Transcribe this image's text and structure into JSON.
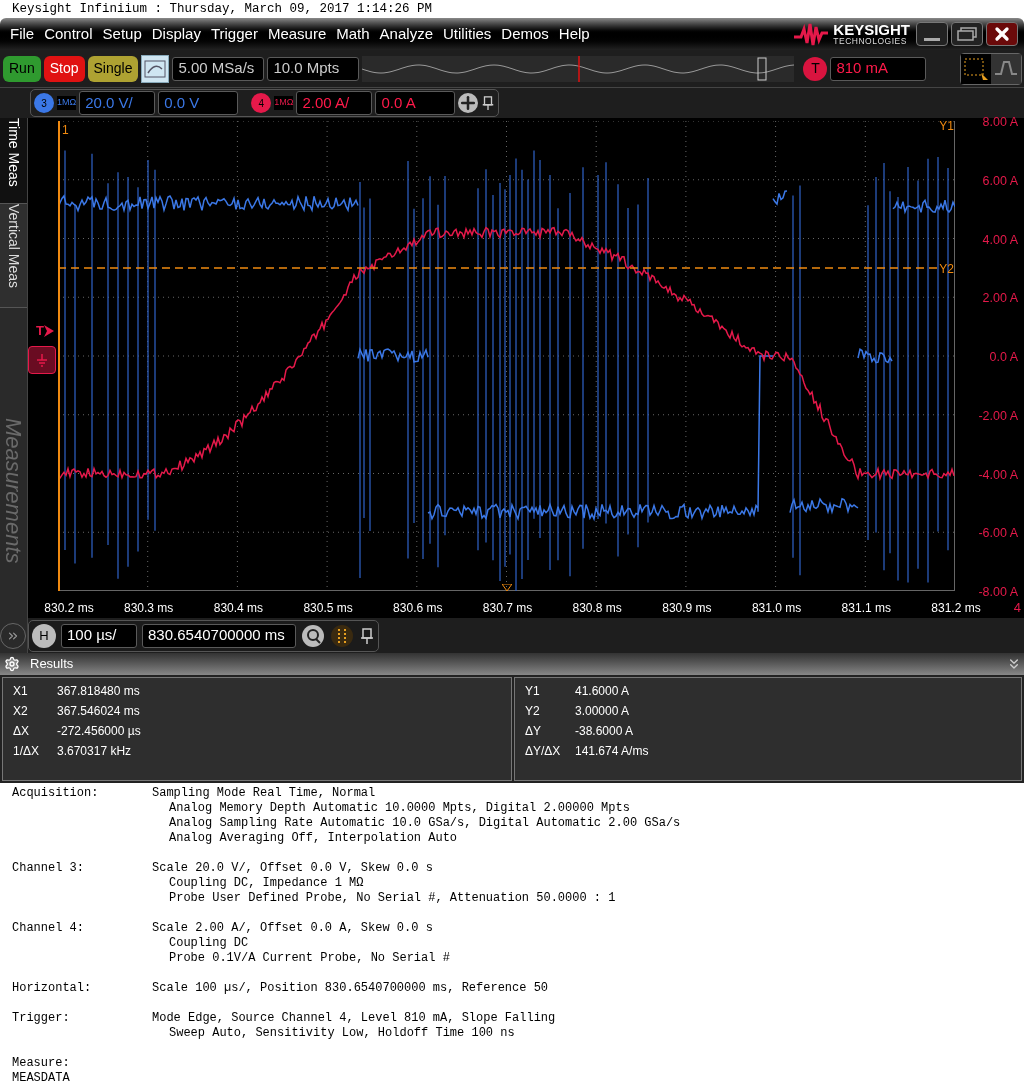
{
  "title_bar": {
    "text": "Keysight Infiniium : Thursday, March 09, 2017 1:14:26 PM"
  },
  "menu": [
    "File",
    "Control",
    "Setup",
    "Display",
    "Trigger",
    "Measure",
    "Math",
    "Analyze",
    "Utilities",
    "Demos",
    "Help"
  ],
  "logo": {
    "name": "KEYSIGHT",
    "subtitle": "TECHNOLOGIES"
  },
  "acquisition_buttons": [
    {
      "label": "Run",
      "color": "#2f9a2f"
    },
    {
      "label": "Stop",
      "color": "#e01212"
    },
    {
      "label": "Single",
      "color": "#aea232"
    }
  ],
  "sample_rate": "5.00 MSa/s",
  "memory_depth": "10.0 Mpts",
  "trigger": {
    "badge": "T",
    "level": "810 mA"
  },
  "view_modes": [
    {
      "kind": "select",
      "selected": true
    },
    {
      "kind": "waveform",
      "selected": false
    }
  ],
  "channels": [
    {
      "number": "3",
      "impedance": "1MΩ",
      "scale": "20.0 V/",
      "offset": "0.0 V",
      "color": "#3b78e7"
    },
    {
      "number": "4",
      "impedance": "1MΩ",
      "scale": "2.00 A/",
      "offset": "0.0 A",
      "color": "#e5194a"
    }
  ],
  "side_tabs": [
    {
      "label": "Time Meas",
      "selected": true
    },
    {
      "label": "Vertical Meas",
      "selected": false
    }
  ],
  "side_panel_label": "Measurements",
  "plot": {
    "x1_label": "1",
    "y1_label": "Y1",
    "y2_label": "Y2",
    "trigger_label": "T",
    "channel_label": "4",
    "y_axis_labels": [
      "8.00 A",
      "6.00 A",
      "4.00 A",
      "2.00 A",
      "0.0 A",
      "-2.00 A",
      "-4.00 A",
      "-6.00 A",
      "-8.00 A"
    ],
    "x_axis_labels": [
      "830.2 ms",
      "830.3 ms",
      "830.4 ms",
      "830.5 ms",
      "830.6 ms",
      "830.7 ms",
      "830.8 ms",
      "830.9 ms",
      "831.0 ms",
      "831.1 ms",
      "831.2 ms"
    ]
  },
  "horizontal": {
    "badge": "H",
    "scale": "100 µs/",
    "position": "830.6540700000 ms"
  },
  "results": {
    "title": "Results",
    "left": [
      {
        "label": "X1",
        "value": "367.818480 ms"
      },
      {
        "label": "X2",
        "value": "367.546024 ms"
      },
      {
        "label": "ΔX",
        "value": "-272.456000 µs"
      },
      {
        "label": "1/ΔX",
        "value": "3.670317 kHz"
      }
    ],
    "right": [
      {
        "label": "Y1",
        "value": "41.6000 A"
      },
      {
        "label": "Y2",
        "value": "3.00000 A"
      },
      {
        "label": "ΔY",
        "value": "-38.6000 A"
      },
      {
        "label": "ΔY/ΔX",
        "value": "141.674 A/ms"
      }
    ]
  },
  "settings_report": [
    {
      "kind": "inline",
      "label": "Acquisition:",
      "lines": [
        "Sampling Mode Real Time, Normal",
        "Analog Memory Depth Automatic 10.0000 Mpts, Digital 2.00000 Mpts",
        "Analog Sampling Rate Automatic 10.0 GSa/s, Digital Automatic 2.00 GSa/s",
        "Analog Averaging Off, Interpolation Auto"
      ]
    },
    {
      "kind": "inline",
      "label": "Channel 3:",
      "lines": [
        "Scale 20.0 V/, Offset 0.0 V, Skew 0.0 s",
        "Coupling DC, Impedance 1 MΩ",
        "Probe User Defined Probe, No Serial #, Attenuation 50.0000 : 1"
      ]
    },
    {
      "kind": "inline",
      "label": "Channel 4:",
      "lines": [
        "Scale 2.00 A/, Offset 0.0 A, Skew 0.0 s",
        "Coupling DC",
        "Probe 0.1V/A Current Probe, No Serial #"
      ]
    },
    {
      "kind": "inline",
      "label": "Horizontal:",
      "lines": [
        "Scale 100 µs/, Position 830.6540700000 ms, Reference 50"
      ]
    },
    {
      "kind": "inline",
      "label": "Trigger:",
      "lines": [
        "Mode Edge, Source Channel 4, Level 810 mA, Slope Falling",
        "Sweep Auto, Sensitivity Low, Holdoff Time 100 ns"
      ]
    },
    {
      "kind": "stacked",
      "label": "Measure:",
      "lines": [
        "MEASDATA"
      ]
    }
  ]
}
